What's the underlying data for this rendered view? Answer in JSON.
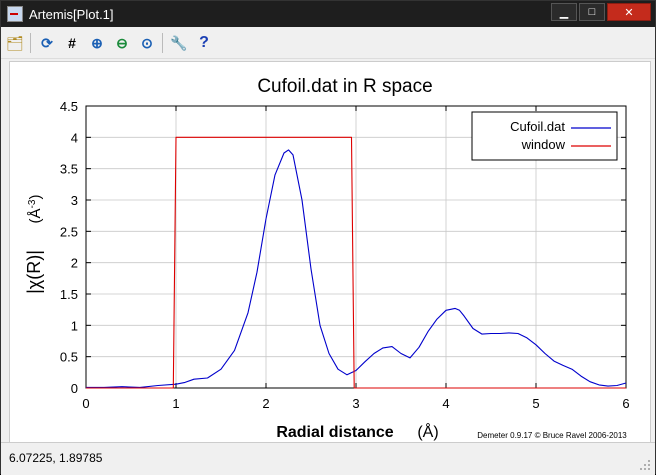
{
  "window": {
    "title": "Artemis[Plot.1]",
    "minimize_label": "▁",
    "maximize_label": "□",
    "close_label": "✕"
  },
  "toolbar": {
    "buttons": [
      {
        "name": "open-folder-icon",
        "glyph": "🗂"
      },
      {
        "name": "refresh-icon",
        "glyph": "⟳"
      },
      {
        "name": "grid-icon",
        "glyph": "#"
      },
      {
        "name": "zoom-in-icon",
        "glyph": "⊕"
      },
      {
        "name": "zoom-out-icon",
        "glyph": "⊖"
      },
      {
        "name": "zoom-reset-icon",
        "glyph": "⊙"
      },
      {
        "name": "wrench-icon",
        "glyph": "🔧"
      },
      {
        "name": "help-icon",
        "glyph": "?"
      }
    ]
  },
  "status": {
    "coords": "6.07225,  1.89785"
  },
  "chart_data": {
    "type": "line",
    "title": "Cufoil.dat in R space",
    "xlabel": "Radial distance",
    "xunit": "(Å)",
    "ylabel": "|χ(R)|",
    "yunit_base": "(Å",
    "yunit_exp": "-3",
    "yunit_close": ")",
    "xlim": [
      0,
      6
    ],
    "ylim": [
      0,
      4.5
    ],
    "xticks": [
      "0",
      "1",
      "2",
      "3",
      "4",
      "5",
      "6"
    ],
    "yticks": [
      "0",
      "0.5",
      "1",
      "1.5",
      "2",
      "2.5",
      "3",
      "3.5",
      "4",
      "4.5"
    ],
    "grid": true,
    "legend_position": "top-right",
    "credit": "Demeter 0.9.17 © Bruce Ravel 2006-2013",
    "series": [
      {
        "name": "Cufoil.dat",
        "color": "#0000cc",
        "x": [
          0,
          0.2,
          0.4,
          0.6,
          0.8,
          1.0,
          1.1,
          1.2,
          1.35,
          1.5,
          1.65,
          1.8,
          1.9,
          2.0,
          2.1,
          2.2,
          2.25,
          2.3,
          2.4,
          2.5,
          2.6,
          2.7,
          2.8,
          2.9,
          3.0,
          3.1,
          3.2,
          3.3,
          3.4,
          3.5,
          3.6,
          3.7,
          3.8,
          3.9,
          4.0,
          4.1,
          4.15,
          4.2,
          4.3,
          4.4,
          4.5,
          4.6,
          4.7,
          4.8,
          4.9,
          5.0,
          5.1,
          5.2,
          5.3,
          5.4,
          5.5,
          5.6,
          5.7,
          5.8,
          5.9,
          6.0
        ],
        "y": [
          0.01,
          0.01,
          0.02,
          0.01,
          0.04,
          0.06,
          0.09,
          0.14,
          0.16,
          0.3,
          0.6,
          1.2,
          1.85,
          2.7,
          3.4,
          3.75,
          3.8,
          3.72,
          3.0,
          1.9,
          1.0,
          0.55,
          0.3,
          0.21,
          0.28,
          0.42,
          0.55,
          0.64,
          0.66,
          0.55,
          0.48,
          0.65,
          0.9,
          1.1,
          1.24,
          1.27,
          1.24,
          1.15,
          0.95,
          0.86,
          0.87,
          0.87,
          0.88,
          0.87,
          0.8,
          0.69,
          0.55,
          0.43,
          0.36,
          0.3,
          0.19,
          0.1,
          0.05,
          0.03,
          0.04,
          0.08
        ]
      },
      {
        "name": "window",
        "color": "#dd0000",
        "x": [
          0,
          0.97,
          1.0,
          2.95,
          2.98,
          6.0
        ],
        "y": [
          0,
          0,
          4.0,
          4.0,
          0,
          0
        ]
      }
    ]
  }
}
